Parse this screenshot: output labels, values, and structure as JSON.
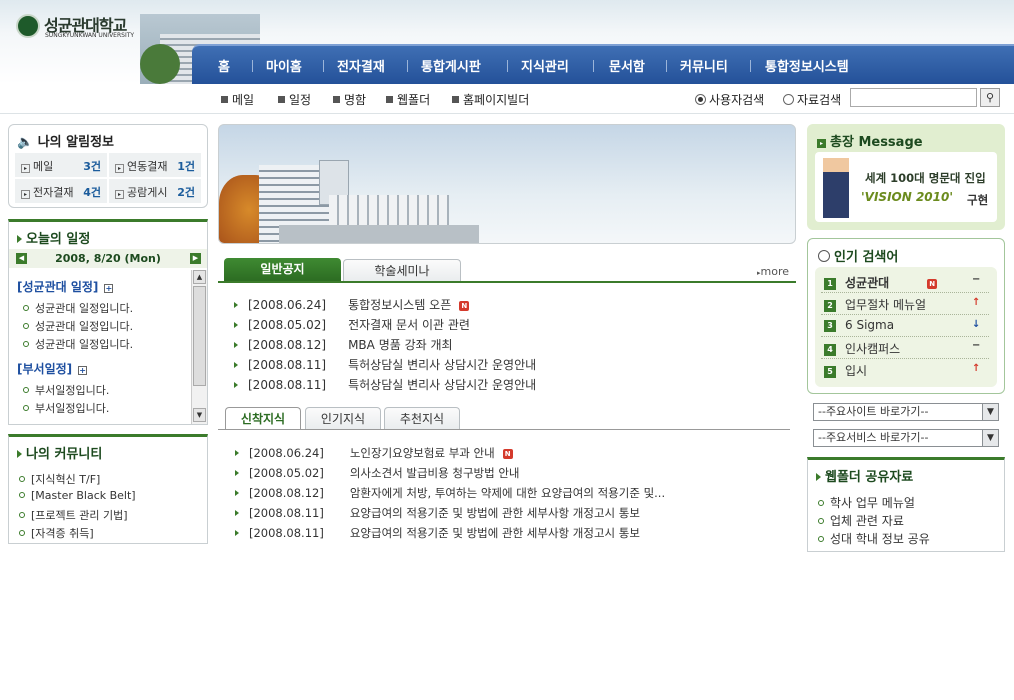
{
  "header": {
    "logo_kr": "성균관대학교",
    "logo_en": "SUNGKYUNKWAN UNIVERSITY",
    "nav": [
      "홈",
      "마이홈",
      "전자결재",
      "통합게시판",
      "지식관리",
      "문서함",
      "커뮤니티",
      "통합정보시스템"
    ]
  },
  "subnav": {
    "links": [
      "메일",
      "일정",
      "명함",
      "웹폴더",
      "홈페이지빌더"
    ],
    "search_options": [
      "사용자검색",
      "자료검색"
    ],
    "search_value": "",
    "search_button_icon": "magnifier-icon"
  },
  "alerts": {
    "title": "나의 알림정보",
    "items": [
      {
        "label": "메일",
        "count": "3건"
      },
      {
        "label": "연동결재",
        "count": "1건"
      },
      {
        "label": "전자결재",
        "count": "4건"
      },
      {
        "label": "공람게시",
        "count": "2건"
      }
    ]
  },
  "schedule": {
    "title": "오늘의 일정",
    "date": "2008, 8/20 (Mon)",
    "sections": [
      {
        "heading": "[성균관대 일정]",
        "items": [
          "성균관대 일정입니다.",
          "성균관대 일정입니다.",
          "성균관대 일정입니다."
        ]
      },
      {
        "heading": "[부서일정]",
        "items": [
          "부서일정입니다.",
          "부서일정입니다."
        ]
      }
    ]
  },
  "community": {
    "title": "나의 커뮤니티",
    "items": [
      "[지식혁신 T/F]",
      "[Master Black Belt]",
      "[프로젝트 관리 기법]",
      "[자격증 취득]"
    ]
  },
  "notices": {
    "tabs": [
      "일반공지",
      "학술세미나"
    ],
    "more": "more",
    "items": [
      {
        "date": "[2008.06.24]",
        "title": "통합정보시스템 오픈",
        "new": true
      },
      {
        "date": "[2008.05.02]",
        "title": "전자결재 문서 이관 관련",
        "new": false
      },
      {
        "date": "[2008.08.12]",
        "title": "MBA 명품 강좌 개최",
        "new": false
      },
      {
        "date": "[2008.08.11]",
        "title": "특허상담실 변리사 상담시간 운영안내",
        "new": false
      },
      {
        "date": "[2008.08.11]",
        "title": "특허상담실 변리사 상담시간 운영안내",
        "new": false
      }
    ]
  },
  "knowledge": {
    "tabs": [
      "신착지식",
      "인기지식",
      "추천지식"
    ],
    "items": [
      {
        "date": "[2008.06.24]",
        "title": "노인장기요양보험료 부과 안내",
        "new": true
      },
      {
        "date": "[2008.05.02]",
        "title": "의사소견서 발급비용 청구방법 안내",
        "new": false
      },
      {
        "date": "[2008.08.12]",
        "title": "암환자에게 처방, 투여하는 약제에 대한 요양급여의 적용기준 및...",
        "new": false
      },
      {
        "date": "[2008.08.11]",
        "title": "요양급여의 적용기준 및 방법에 관한 세부사항 개정고시 통보",
        "new": false
      },
      {
        "date": "[2008.08.11]",
        "title": "요양급여의 적용기준 및 방법에 관한 세부사항 개정고시 통보",
        "new": false
      }
    ]
  },
  "president": {
    "title": "총장 Message",
    "slogan": "세계 100대 명문대 진입",
    "vision": "'VISION 2010'",
    "suffix": "구현"
  },
  "popular": {
    "title": "인기 검색어",
    "items": [
      {
        "rank": "1",
        "term": "성균관대",
        "new": true,
        "trend": "−",
        "trend_color": "#333333"
      },
      {
        "rank": "2",
        "term": "업무절차 메뉴얼",
        "new": false,
        "trend": "↑",
        "trend_color": "#d43a2c"
      },
      {
        "rank": "3",
        "term": "6 Sigma",
        "new": false,
        "trend": "↓",
        "trend_color": "#1e4fa0"
      },
      {
        "rank": "4",
        "term": "인사캠퍼스",
        "new": false,
        "trend": "−",
        "trend_color": "#333333"
      },
      {
        "rank": "5",
        "term": "입시",
        "new": false,
        "trend": "↑",
        "trend_color": "#d43a2c"
      }
    ]
  },
  "quicklinks": {
    "site": "--주요사이트 바로가기--",
    "service": "--주요서비스 바로가기--"
  },
  "webfolder": {
    "title": "웹폴더 공유자료",
    "items": [
      "학사 업무 메뉴얼",
      "업체 관련 자료",
      "성대 학내 정보 공유"
    ]
  }
}
